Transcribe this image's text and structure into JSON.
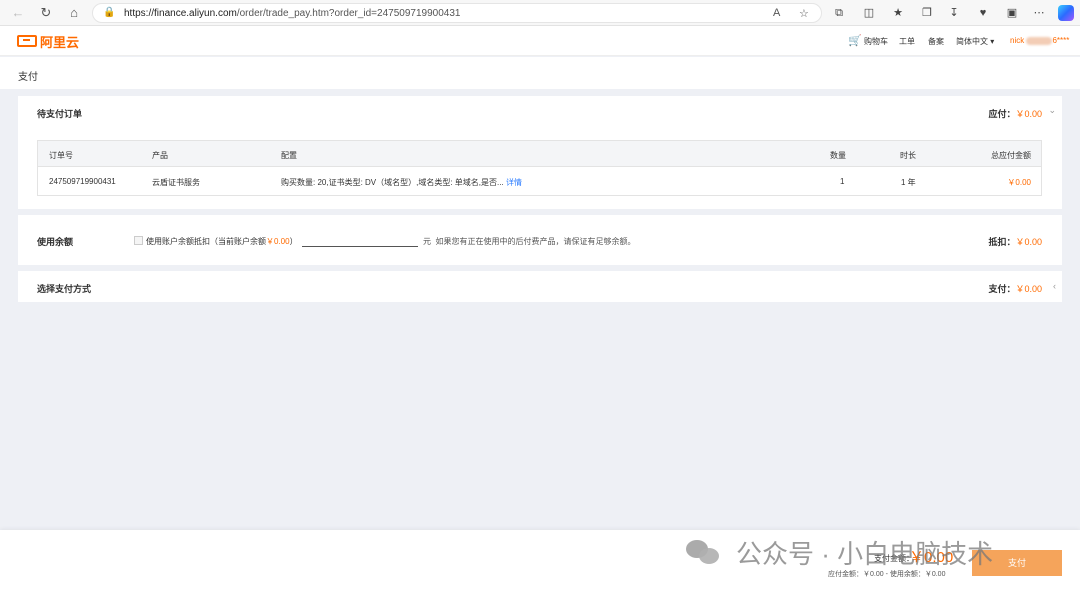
{
  "browser": {
    "url_host": "https://finance.aliyun.com",
    "url_path": "/order/trade_pay.htm?order_id=247509719900431"
  },
  "header": {
    "logo_text": "阿里云",
    "cart": "购物车",
    "ticket": "工单",
    "filing": "备案",
    "language": "简体中文",
    "user_prefix": "nick",
    "user_suffix": "6****"
  },
  "page_title": "支付",
  "order_section": {
    "title": "待支付订单",
    "due_label": "应付：",
    "due_amount": "￥0.00",
    "columns": [
      "订单号",
      "产品",
      "配置",
      "数量",
      "时长",
      "总应付金额"
    ],
    "row": {
      "order_id": "247509719900431",
      "product": "云盾证书服务",
      "config": "购买数量: 20,证书类型: DV（域名型）,域名类型: 单域名,是否...",
      "detail": "详情",
      "quantity": "1",
      "duration": "1 年",
      "total": "￥0.00"
    }
  },
  "balance_section": {
    "title": "使用余额",
    "checkbox_label": "使用账户余额抵扣（当前账户余额",
    "current_balance": "￥0.00",
    "close_paren": "）",
    "input_value": "",
    "unit": "元",
    "note": "如果您有正在使用中的后付费产品，请保证有足够余额。",
    "deduct_label": "抵扣：",
    "deduct_amount": "￥0.00"
  },
  "payment_section": {
    "title": "选择支付方式",
    "pay_label": "支付：",
    "pay_amount": "￥0.00"
  },
  "footer": {
    "pay_total_label": "支付金额：",
    "pay_total_amount": "￥0.00",
    "summary": "应付金额：￥0.00 - 使用余额：￥0.00",
    "pay_button": "支付"
  },
  "watermark": {
    "text": "公众号 · 小白电脑技术"
  },
  "colors": {
    "brand": "#ff6a00",
    "link": "#2b7cff",
    "pay_button": "#f5a45b"
  }
}
